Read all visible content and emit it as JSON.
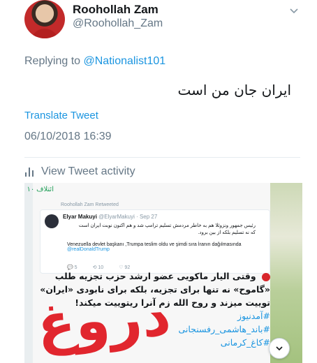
{
  "tweet": {
    "display_name": "Roohollah Zam",
    "handle": "@Roohollah_Zam",
    "replying_prefix": "Replying to",
    "replying_to": "@Nationalist101",
    "text": "ایران جان من است",
    "translate_label": "Translate Tweet",
    "timestamp": "06/10/2018 16:39",
    "activity_label": "View Tweet activity"
  },
  "media": {
    "top_bar_text": "ائتلاف ۱۰",
    "retweet_note": "Roohollah Zam Retweeted",
    "inner_tweet": {
      "name": "Elyar Makuyi",
      "handle": "@ElyarMakuyi · Sep 27",
      "text_fa": "رئیس جمهور ونزوئلا هم به خاطر مردمش تسلیم ترامپ شد و هم اکنون نوبت ایران است که نه تسلیم بلکه از بین برود.",
      "text_tr": "Venezuella devlet başkanı ,Trumpa teslim oldu ve şimdi sıra İranın dağılmasında",
      "mention": "@realDonaldTrump",
      "replies": "5",
      "retweets": "10",
      "likes": "92"
    },
    "body_fa": "وقتی الیار ماکویی عضو ارشد حزب تجزیه طلب «گاموح» نه تنها برای تجزیه، بلکه برای نابودی «ایران» توییت میزند و روح الله زم آنرا ریتوییت میکند!",
    "hashtags": [
      "#آمدنیوز",
      "#باند_هاشمی_رفسنجانی",
      "#کاغ_کرمانی"
    ],
    "stamp": "دروغ"
  },
  "colors": {
    "link": "#1b95e0",
    "muted": "#657786",
    "stamp_red": "#e01b24"
  },
  "icons": [
    "chevron-down-icon",
    "bar-chart-icon",
    "chevron-down-icon"
  ]
}
